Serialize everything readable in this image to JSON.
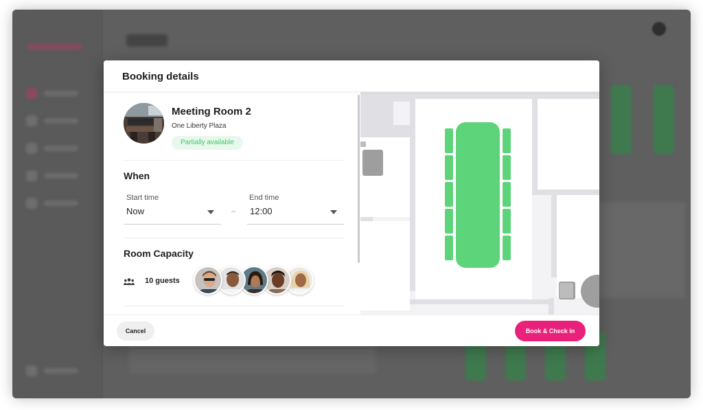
{
  "modal": {
    "title": "Booking details",
    "room": {
      "name": "Meeting Room 2",
      "location": "One Liberty Plaza",
      "availability": "Partially available"
    },
    "when": {
      "title": "When",
      "start_label": "Start time",
      "start_value": "Now",
      "separator": "–",
      "end_label": "End time",
      "end_value": "12:00"
    },
    "capacity": {
      "title": "Room Capacity",
      "guests": "10 guests",
      "avatar_count": 5
    },
    "footer": {
      "cancel_label": "Cancel",
      "book_label": "Book & Check in"
    }
  },
  "colors": {
    "accent": "#e9217a",
    "available_green": "#5ed47a",
    "badge_bg": "#e8f8ec",
    "badge_text": "#3ec66a"
  },
  "icons": [
    "group-icon",
    "chevron-down-icon"
  ]
}
